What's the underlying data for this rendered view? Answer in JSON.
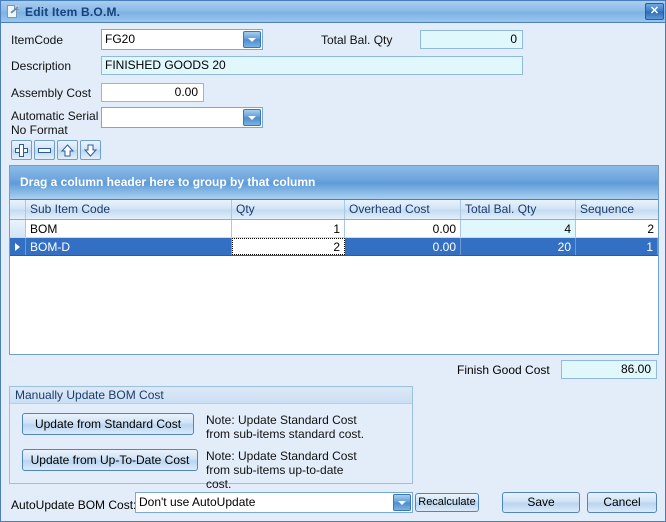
{
  "window": {
    "title": "Edit Item B.O.M.",
    "title_icon": "edit-document-icon",
    "close_label": "✕",
    "accent_blue": "#3370c4",
    "titlebar_blue": "#8dbbe8",
    "readonly_field_bg": "#e0f7fb"
  },
  "form": {
    "itemcode_label": "ItemCode",
    "itemcode_value": "FG20",
    "description_label": "Description",
    "description_value": "FINISHED GOODS 20",
    "assembly_cost_label": "Assembly Cost",
    "assembly_cost_value": "0.00",
    "serial_label_line1": "Automatic Serial",
    "serial_label_line2": "No Format",
    "serial_value": "",
    "total_bal_qty_label": "Total Bal. Qty",
    "total_bal_qty_value": "0"
  },
  "toolbar": {
    "add_icon": "plus-icon",
    "remove_icon": "minus-icon",
    "move_up_icon": "arrow-up-icon",
    "move_down_icon": "arrow-down-icon"
  },
  "grid": {
    "group_panel_text": "Drag a column header here to group by that column",
    "columns": [
      "Sub Item Code",
      "Qty",
      "Overhead Cost",
      "Total Bal. Qty",
      "Sequence"
    ],
    "rows": [
      {
        "sub_item_code": "BOM",
        "qty": "1",
        "overhead_cost": "0.00",
        "total_bal_qty": "4",
        "sequence": "2",
        "selected": false
      },
      {
        "sub_item_code": "BOM-D",
        "qty": "2",
        "overhead_cost": "0.00",
        "total_bal_qty": "20",
        "sequence": "1",
        "selected": true
      }
    ]
  },
  "finish_good_cost": {
    "label": "Finish Good Cost",
    "value": "86.00"
  },
  "manual_update": {
    "title": "Manually Update BOM Cost",
    "standard_button": "Update from Standard Cost",
    "standard_note": "Note: Update Standard Cost from sub-items standard cost.",
    "uptodate_button": "Update from Up-To-Date Cost",
    "uptodate_note": "Note: Update Standard Cost from sub-items up-to-date cost."
  },
  "bottom": {
    "autoupdate_label": "AutoUpdate BOM Cost:",
    "autoupdate_value": "Don't use AutoUpdate",
    "recalculate_button": "Recalculate",
    "save_button": "Save",
    "cancel_button": "Cancel"
  }
}
